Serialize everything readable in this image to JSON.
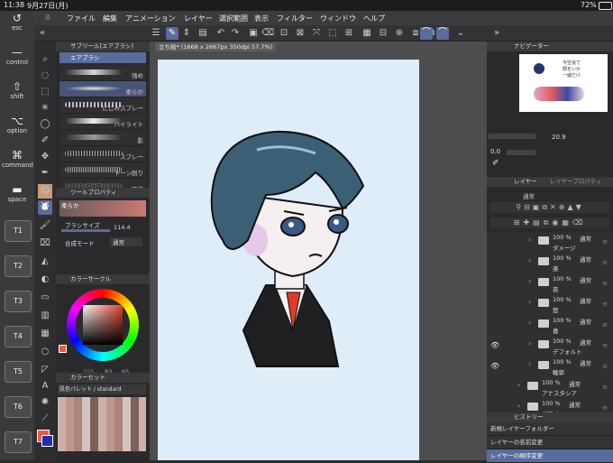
{
  "status": {
    "time": "11:38",
    "date": "9月27日(月)",
    "battery": "72%"
  },
  "shortcuts": {
    "esc": "esc",
    "control": "control",
    "shift": "shift",
    "option": "option",
    "command": "command",
    "space": "space",
    "keys": [
      "T1",
      "T2",
      "T3",
      "T4",
      "T5",
      "T6",
      "T7"
    ]
  },
  "menu": [
    "ファイル",
    "編集",
    "アニメーション",
    "レイヤー",
    "選択範囲",
    "表示",
    "フィルター",
    "ウィンドウ",
    "ヘルプ"
  ],
  "subtool": {
    "header": "サブツール[エアブラシ]",
    "group": "エアブラシ",
    "items": [
      "强め",
      "柔らか",
      "にじみスプレー",
      "ハイライト",
      "影",
      "スプレー",
      "トーン削り",
      "飛沫"
    ]
  },
  "toolprops": {
    "header": "ツールプロパティ",
    "preset": "柔らか",
    "brush_size_label": "ブラシサイズ",
    "brush_size_value": "114.4",
    "blend_label": "合成モード",
    "blend_value": "通常"
  },
  "colorcircle": {
    "header": "カラーサークル",
    "r": "255",
    "g": "83",
    "b": "65",
    "main_color": "#e85a48"
  },
  "colorset": {
    "header": "カラーセット",
    "palette": "肌色パレット / standard"
  },
  "document": {
    "tab": "立ち絵* (1668 x 2667px 350dpi 57.7%)"
  },
  "navigator": {
    "header": "ナビゲーター",
    "zoom": "20.9",
    "rotate": "0.0",
    "note_line1": "今空追で",
    "note_line2": "顔をいか",
    "note_line3": "一緒だけ"
  },
  "layers": {
    "header": "レイヤー",
    "header2": "レイヤープロパティ",
    "blend": "通常",
    "items": [
      {
        "opacity": "100 %",
        "mode": "通常",
        "name": "ダメージ",
        "visible": false,
        "indent": true
      },
      {
        "opacity": "100 %",
        "mode": "通常",
        "name": "楽",
        "visible": false,
        "indent": true
      },
      {
        "opacity": "100 %",
        "mode": "通常",
        "name": "哀",
        "visible": false,
        "indent": true
      },
      {
        "opacity": "100 %",
        "mode": "通常",
        "name": "怒",
        "visible": false,
        "indent": true
      },
      {
        "opacity": "100 %",
        "mode": "通常",
        "name": "喜",
        "visible": false,
        "indent": true
      },
      {
        "opacity": "100 %",
        "mode": "通常",
        "name": "デフォルト",
        "visible": true,
        "indent": true
      },
      {
        "opacity": "100 %",
        "mode": "通常",
        "name": "輪郭",
        "visible": true,
        "indent": true
      },
      {
        "opacity": "100 %",
        "mode": "通常",
        "name": "アナスタシア",
        "visible": false,
        "indent": false
      },
      {
        "opacity": "100 %",
        "mode": "通常",
        "name": "ダフネ",
        "visible": false,
        "indent": false
      }
    ]
  },
  "history": {
    "header": "ヒストリー",
    "items": [
      "新規レイヤーフォルダー",
      "レイヤーの名前変更",
      "レイヤーの順序変更"
    ]
  },
  "colors": {
    "accent": "#5a6c9c",
    "canvas_bg": "#deedf7"
  }
}
